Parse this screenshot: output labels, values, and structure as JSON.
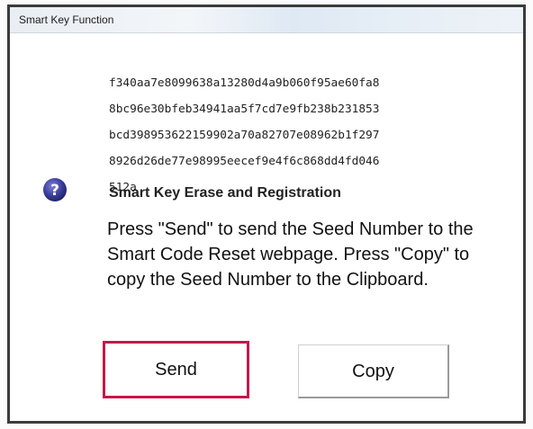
{
  "window": {
    "title": "Smart Key Function"
  },
  "seed": {
    "lines": [
      "f340aa7e8099638a13280d4a9b060f95ae60fa8",
      "8bc96e30bfeb34941aa5f7cd7e9fb238b231853",
      "bcd398953622159902a70a82707e08962b1f297",
      "8926d26de77e98995eecef9e4f6c868dd4fd046",
      "512a"
    ]
  },
  "icon": {
    "name": "question-icon",
    "color": "#3c3f9e"
  },
  "heading": "Smart Key Erase and Registration",
  "message": "Press \"Send\" to send the Seed Number to the Smart Code Reset webpage. Press \"Copy\" to copy the Seed Number to the Clipboard.",
  "buttons": {
    "send_label": "Send",
    "copy_label": "Copy"
  },
  "colors": {
    "focus_border": "#c4184b"
  }
}
